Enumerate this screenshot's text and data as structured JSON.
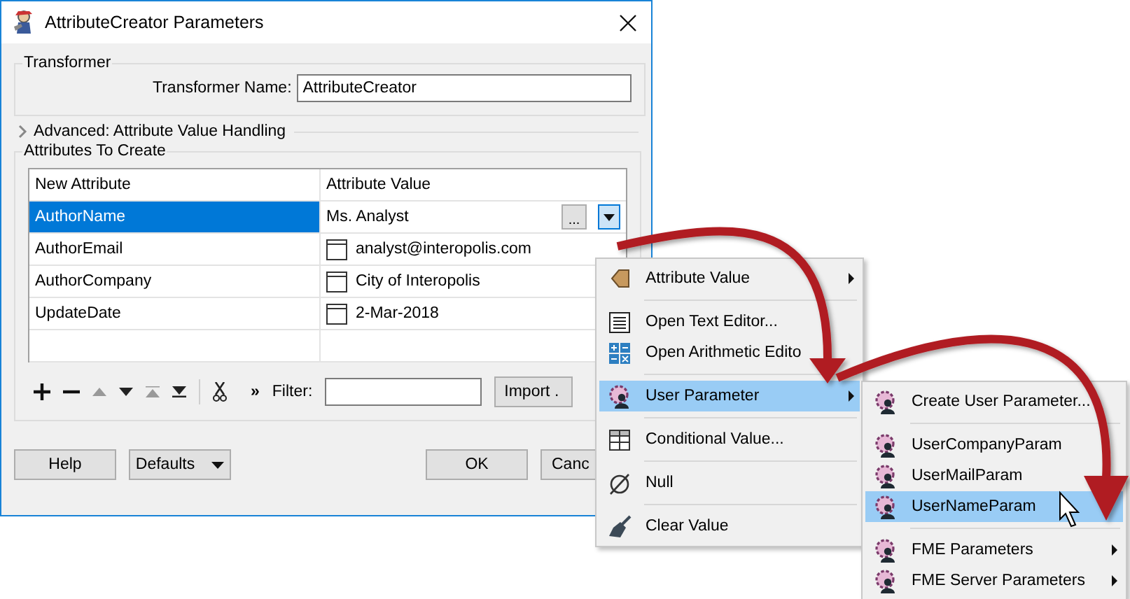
{
  "window": {
    "title": "AttributeCreator Parameters"
  },
  "transformer": {
    "group_title": "Transformer",
    "name_label": "Transformer Name:",
    "name_value": "AttributeCreator"
  },
  "advanced": {
    "label": "Advanced: Attribute Value Handling",
    "expanded": false
  },
  "attributes": {
    "group_title": "Attributes To Create",
    "columns": [
      "New Attribute",
      "Attribute Value"
    ],
    "rows": [
      {
        "name": "AuthorName",
        "value": "Ms. Analyst",
        "kind": "editing",
        "selected": true,
        "editor_button": "..."
      },
      {
        "name": "AuthorEmail",
        "value": "analyst@interopolis.com",
        "kind": "text",
        "selected": false
      },
      {
        "name": "AuthorCompany",
        "value": "City of Interopolis",
        "kind": "text",
        "selected": false
      },
      {
        "name": "UpdateDate",
        "value": "2-Mar-2018",
        "kind": "text",
        "selected": false
      }
    ],
    "more": "»",
    "filter_label": "Filter:",
    "import_button": "Import ."
  },
  "buttons": {
    "help": "Help",
    "defaults": "Defaults",
    "ok": "OK",
    "cancel": "Canc"
  },
  "context_menu": {
    "items": [
      {
        "kind": "attribute",
        "label": "Attribute Value",
        "has_submenu": true,
        "selected": false
      },
      {
        "kind": "separator"
      },
      {
        "kind": "text-editor",
        "label": "Open Text Editor...",
        "has_submenu": false,
        "selected": false
      },
      {
        "kind": "arithmetic",
        "label": "Open Arithmetic Edito",
        "has_submenu": false,
        "selected": false
      },
      {
        "kind": "separator"
      },
      {
        "kind": "user-param",
        "label": "User Parameter",
        "has_submenu": true,
        "selected": true
      },
      {
        "kind": "separator"
      },
      {
        "kind": "conditional",
        "label": "Conditional Value...",
        "has_submenu": false,
        "selected": false
      },
      {
        "kind": "separator"
      },
      {
        "kind": "null",
        "label": "Null",
        "has_submenu": false,
        "selected": false
      },
      {
        "kind": "separator"
      },
      {
        "kind": "clear",
        "label": "Clear Value",
        "has_submenu": false,
        "selected": false
      }
    ]
  },
  "submenu": {
    "items": [
      {
        "kind": "user-param",
        "label": "Create User Parameter...",
        "has_submenu": false,
        "selected": false
      },
      {
        "kind": "separator"
      },
      {
        "kind": "user-param",
        "label": "UserCompanyParam",
        "has_submenu": false,
        "selected": false
      },
      {
        "kind": "user-param",
        "label": "UserMailParam",
        "has_submenu": false,
        "selected": false
      },
      {
        "kind": "user-param",
        "label": "UserNameParam",
        "has_submenu": false,
        "selected": true
      },
      {
        "kind": "separator"
      },
      {
        "kind": "user-param",
        "label": "FME Parameters",
        "has_submenu": true,
        "selected": false
      },
      {
        "kind": "user-param",
        "label": "FME Server Parameters",
        "has_submenu": true,
        "selected": false
      }
    ]
  }
}
